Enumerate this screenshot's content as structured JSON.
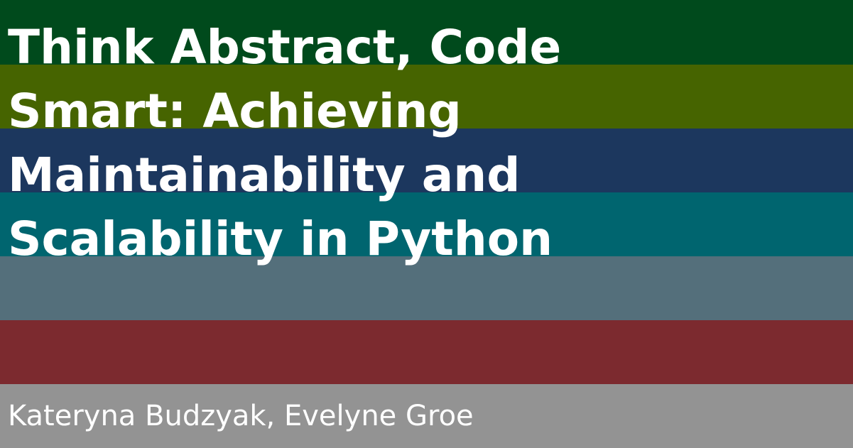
{
  "title_lines": [
    "Think Abstract, Code",
    "Smart: Achieving",
    "Maintainability and",
    "Scalability in Python"
  ],
  "authors": "Kateryna Budzyak, Evelyne Groe",
  "stripe_colors": [
    "#004a1c",
    "#466400",
    "#1c375e",
    "#00656f",
    "#546f7b",
    "#7c2a2f",
    "#939393"
  ]
}
